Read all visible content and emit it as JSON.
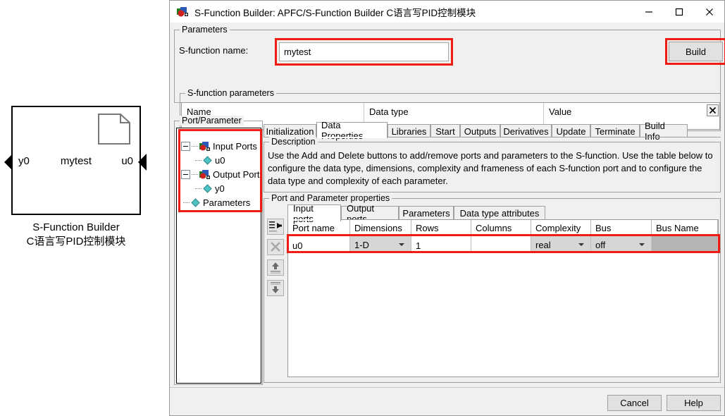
{
  "canvas": {
    "block": {
      "name": "mytest",
      "input_port_label": "u0",
      "output_port_label": "y0",
      "icon": "document-icon",
      "caption_line1": "S-Function Builder",
      "caption_line2": "C语言写PID控制模块"
    }
  },
  "window": {
    "title": "S-Function Builder: APFC/S-Function Builder C语言写PID控制模块",
    "icon": "sfunction-builder-icon",
    "controls": {
      "minimize": "minimize-icon",
      "maximize": "maximize-icon",
      "close": "close-icon"
    }
  },
  "parameters_group": {
    "title": "Parameters",
    "sfunction_name_label": "S-function name:",
    "sfunction_name_value": "mytest",
    "sfunction_name_placeholder": "",
    "build_button": "Build",
    "highlight_color": "#ee1c13"
  },
  "sfunction_parameters": {
    "title": "S-function parameters",
    "columns": [
      "Name",
      "Data type",
      "Value"
    ],
    "rows": [],
    "close_button": "close-table-icon"
  },
  "port_parameter_tree": {
    "title": "Port/Parameter",
    "nodes": [
      {
        "label": "Input Ports",
        "icon": "port-icon",
        "expander": "minus",
        "level": 0
      },
      {
        "label": "u0",
        "icon": "diamond-icon",
        "expander": "none",
        "level": 1
      },
      {
        "label": "Output Ports",
        "icon": "port-icon",
        "expander": "minus",
        "level": 0
      },
      {
        "label": "y0",
        "icon": "diamond-icon",
        "expander": "none",
        "level": 1
      },
      {
        "label": "Parameters",
        "icon": "diamond-icon",
        "expander": "none",
        "level": 0
      }
    ]
  },
  "tabs": {
    "items": [
      {
        "label": "Initialization",
        "active": false
      },
      {
        "label": "Data Properties",
        "active": true
      },
      {
        "label": "Libraries",
        "active": false
      },
      {
        "label": "Start",
        "active": false
      },
      {
        "label": "Outputs",
        "active": false
      },
      {
        "label": "Derivatives",
        "active": false
      },
      {
        "label": "Update",
        "active": false
      },
      {
        "label": "Terminate",
        "active": false
      },
      {
        "label": "Build Info",
        "active": false
      }
    ]
  },
  "description": {
    "title": "Description",
    "text": "Use the Add and Delete buttons to add/remove ports and parameters to the S-function. Use the table below to configure the data type, dimensions, complexity and frameness of each S-function port and to configure the data type and complexity of each parameter."
  },
  "port_properties": {
    "title": "Port and Parameter properties",
    "subtabs": [
      {
        "label": "Input ports",
        "active": true
      },
      {
        "label": "Output ports",
        "active": false
      },
      {
        "label": "Parameters",
        "active": false
      },
      {
        "label": "Data type attributes",
        "active": false
      }
    ],
    "tools": [
      {
        "name": "add-port-button",
        "enabled": true
      },
      {
        "name": "delete-port-button",
        "enabled": false
      },
      {
        "name": "move-up-button",
        "enabled": true
      },
      {
        "name": "move-down-button",
        "enabled": true
      }
    ],
    "columns": [
      "Port name",
      "Dimensions",
      "Rows",
      "Columns",
      "Complexity",
      "Bus",
      "Bus Name"
    ],
    "rows": [
      {
        "port_name": "u0",
        "dimensions": "1-D",
        "rows": "1",
        "columns": "",
        "complexity": "real",
        "bus": "off",
        "bus_name": ""
      }
    ]
  },
  "footer": {
    "cancel": "Cancel",
    "help": "Help"
  }
}
